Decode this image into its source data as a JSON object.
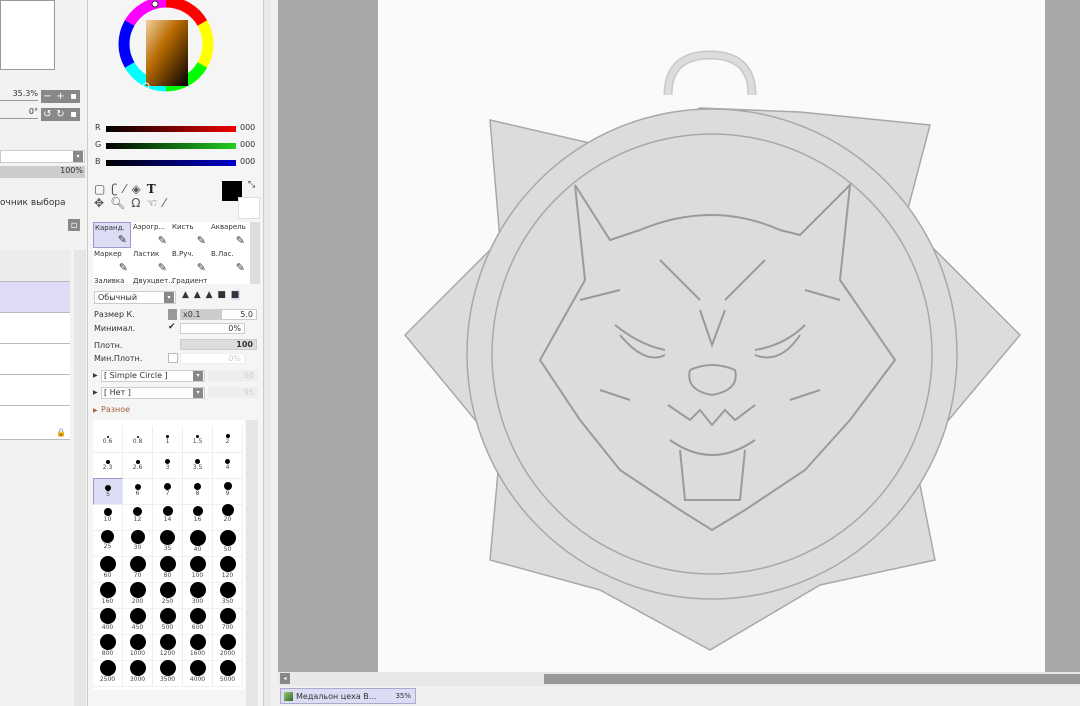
{
  "navigator": {
    "zoom": "35.3%",
    "angle": "0°"
  },
  "layer_panel": {
    "opacity": "100%",
    "selection_source": "очник выбора"
  },
  "color": {
    "r_label": "R",
    "g_label": "G",
    "b_label": "B",
    "r": "000",
    "g": "000",
    "b": "000",
    "fg": "#000000",
    "bg": "#ffffff"
  },
  "tools": [
    "Каранд.",
    "Аэрогр...",
    "Кисть",
    "Акварель",
    "Маркер",
    "Ластик",
    "В.Руч.",
    "В.Лас.",
    "Заливка",
    "Двухцвет...",
    "Градиент"
  ],
  "brush": {
    "blend_mode": "Обычный",
    "size_label": "Размер К.",
    "size_mult": "x0.1",
    "size": "5.0",
    "min_size_label": "Минимал.",
    "min_size": "0%",
    "density_label": "Плотн.",
    "density": "100",
    "min_density_label": "Мин.Плотн.",
    "min_density": "0%",
    "shape": "[ Simple Circle ]",
    "shape_val": "50",
    "texture": "[ Нет ]",
    "texture_val": "95",
    "misc": "Разное"
  },
  "brush_sizes": [
    "0.6",
    "0.8",
    "1",
    "1.5",
    "2",
    "2.3",
    "2.6",
    "3",
    "3.5",
    "4",
    "5",
    "6",
    "7",
    "8",
    "9",
    "10",
    "12",
    "14",
    "16",
    "20",
    "25",
    "30",
    "35",
    "40",
    "50",
    "60",
    "70",
    "80",
    "100",
    "120",
    "160",
    "200",
    "250",
    "300",
    "350",
    "400",
    "450",
    "500",
    "600",
    "700",
    "800",
    "1000",
    "1200",
    "1600",
    "2000",
    "2500",
    "3000",
    "3500",
    "4000",
    "5000"
  ],
  "selected_size": "5",
  "document_tab": {
    "name": "Медальон цеха В...",
    "zoom": "35%"
  }
}
